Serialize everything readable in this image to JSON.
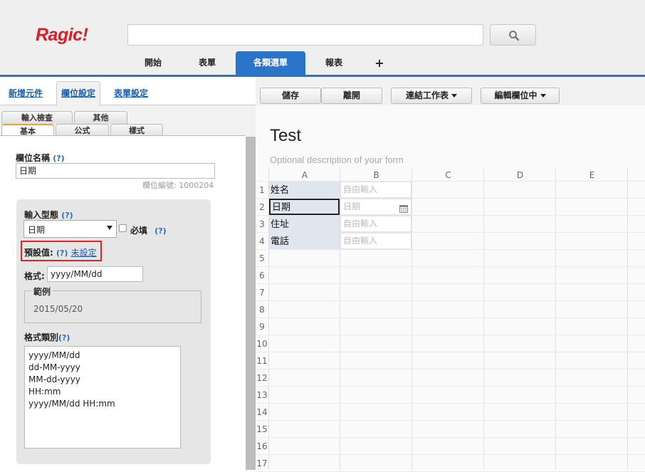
{
  "app": {
    "logo": "Ragic!"
  },
  "header": {
    "search": {
      "value": "",
      "placeholder": ""
    },
    "nav_tabs": [
      {
        "label": "開始"
      },
      {
        "label": "表單"
      },
      {
        "label": "各類選單",
        "active": true
      },
      {
        "label": "報表"
      },
      {
        "label": "+"
      }
    ]
  },
  "left_panel": {
    "tabs": [
      {
        "label": "新增元件"
      },
      {
        "label": "欄位設定",
        "active": true
      },
      {
        "label": "表單設定"
      }
    ],
    "subtabs_row1": [
      {
        "label": "輸入檢查"
      },
      {
        "label": "其他"
      }
    ],
    "subtabs_row2": [
      {
        "label": "基本",
        "active": true
      },
      {
        "label": "公式"
      },
      {
        "label": "樣式"
      }
    ],
    "field_name_label": "欄位名稱",
    "help": "(?)",
    "field_name_value": "日期",
    "field_id_text": "欄位編號: 1000204",
    "input_type_label": "輸入型態",
    "input_type_value": "日期",
    "required_label": "必填",
    "required_checked": false,
    "default_label": "預設值:",
    "default_link": "未設定",
    "format_label": "格式:",
    "format_value": "yyyy/MM/dd",
    "example_legend": "範例",
    "example_value": "2015/05/20",
    "format_category_label": "格式類別",
    "format_options": [
      "yyyy/MM/dd",
      "dd-MM-yyyy",
      "MM-dd-yyyy",
      "HH:mm",
      "yyyy/MM/dd HH:mm"
    ]
  },
  "right_panel": {
    "toolbar": {
      "save": "儲存",
      "leave": "離開",
      "link_sheet": "連結工作表",
      "edit_mode": "編輯欄位中"
    },
    "form_title": "Test",
    "form_description": "Optional description of your form",
    "columns": [
      "A",
      "B",
      "C",
      "D",
      "E"
    ],
    "rows": [
      {
        "num": "1",
        "a": "姓名",
        "b": "自由輸入"
      },
      {
        "num": "2",
        "a": "日期",
        "b": "日期",
        "selected": true,
        "calendar": true
      },
      {
        "num": "3",
        "a": "住址",
        "b": "自由輸入"
      },
      {
        "num": "4",
        "a": "電話",
        "b": "自由輸入"
      },
      {
        "num": "5"
      },
      {
        "num": "6"
      },
      {
        "num": "7"
      },
      {
        "num": "8"
      },
      {
        "num": "9"
      },
      {
        "num": "10"
      },
      {
        "num": "11"
      },
      {
        "num": "12"
      },
      {
        "num": "13"
      },
      {
        "num": "14"
      },
      {
        "num": "15"
      },
      {
        "num": "16"
      },
      {
        "num": "17"
      }
    ]
  },
  "colors": {
    "brand_red": "#d71f26",
    "accent_blue": "#2a74c9",
    "highlight_red": "#d8282e"
  }
}
